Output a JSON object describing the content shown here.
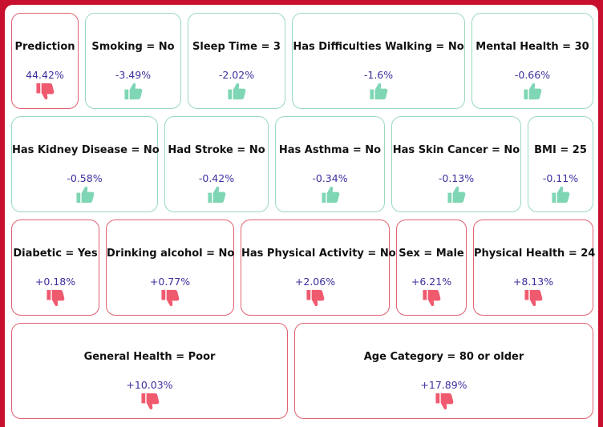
{
  "colors": {
    "frame": "#c8102e",
    "good_border": "#9ad9bd",
    "bad_border": "#e0606e",
    "good_icon": "#7fd6b4",
    "bad_icon": "#ef5a6f",
    "value_text": "#3a2f9e"
  },
  "cards": [
    {
      "label": "Prediction",
      "value": "44.42%",
      "icon": "thumbs-down-icon",
      "tone": "bad"
    },
    {
      "label": "Smoking = No",
      "value": "-3.49%",
      "icon": "thumbs-up-icon",
      "tone": "good"
    },
    {
      "label": "Sleep Time = 3",
      "value": "-2.02%",
      "icon": "thumbs-up-icon",
      "tone": "good"
    },
    {
      "label": "Has Difficulties Walking = No",
      "value": "-1.6%",
      "icon": "thumbs-up-icon",
      "tone": "good"
    },
    {
      "label": "Mental Health = 30",
      "value": "-0.66%",
      "icon": "thumbs-up-icon",
      "tone": "good"
    },
    {
      "label": "Has Kidney Disease = No",
      "value": "-0.58%",
      "icon": "thumbs-up-icon",
      "tone": "good"
    },
    {
      "label": "Had Stroke = No",
      "value": "-0.42%",
      "icon": "thumbs-up-icon",
      "tone": "good"
    },
    {
      "label": "Has Asthma = No",
      "value": "-0.34%",
      "icon": "thumbs-up-icon",
      "tone": "good"
    },
    {
      "label": "Has Skin Cancer = No",
      "value": "-0.13%",
      "icon": "thumbs-up-icon",
      "tone": "good"
    },
    {
      "label": "BMI = 25",
      "value": "-0.11%",
      "icon": "thumbs-up-icon",
      "tone": "good"
    },
    {
      "label": "Diabetic = Yes",
      "value": "+0.18%",
      "icon": "thumbs-down-icon",
      "tone": "bad"
    },
    {
      "label": "Drinking alcohol = No",
      "value": "+0.77%",
      "icon": "thumbs-down-icon",
      "tone": "bad"
    },
    {
      "label": "Has Physical Activity = No",
      "value": "+2.06%",
      "icon": "thumbs-down-icon",
      "tone": "bad"
    },
    {
      "label": "Sex = Male",
      "value": "+6.21%",
      "icon": "thumbs-down-icon",
      "tone": "bad"
    },
    {
      "label": "Physical Health = 24",
      "value": "+8.13%",
      "icon": "thumbs-down-icon",
      "tone": "bad"
    },
    {
      "label": "General Health = Poor",
      "value": "+10.03%",
      "icon": "thumbs-down-icon",
      "tone": "bad"
    },
    {
      "label": "Age Category = 80 or older",
      "value": "+17.89%",
      "icon": "thumbs-down-icon",
      "tone": "bad"
    }
  ]
}
